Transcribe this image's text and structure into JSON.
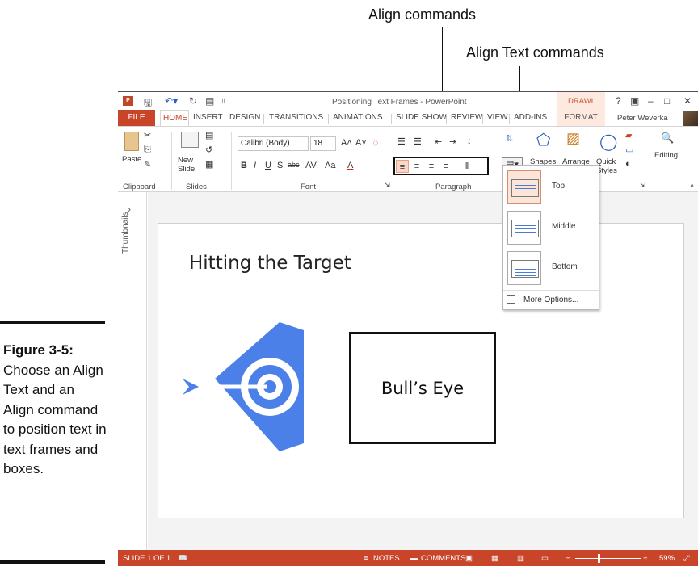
{
  "callouts": {
    "align_commands": "Align commands",
    "align_text_commands": "Align Text commands"
  },
  "figure": {
    "number": "Figure 3-5:",
    "caption": "Choose an Align Text and an Align command to position text in text frames and boxes."
  },
  "window": {
    "title": "Positioning Text Frames - PowerPoint",
    "context_tab": "DRAWI...",
    "user": "Peter Weverka",
    "help": "?"
  },
  "tabs": [
    "FILE",
    "HOME",
    "INSERT",
    "DESIGN",
    "TRANSITIONS",
    "ANIMATIONS",
    "SLIDE SHOW",
    "REVIEW",
    "VIEW",
    "ADD-INS",
    "FORMAT"
  ],
  "ribbon": {
    "clipboard": {
      "paste": "Paste",
      "group": "Clipboard"
    },
    "slides": {
      "new_slide": "New Slide",
      "group": "Slides"
    },
    "font": {
      "family": "Calibri (Body)",
      "size": "18",
      "group": "Font"
    },
    "paragraph": {
      "group": "Paragraph"
    },
    "drawing": {
      "shapes": "Shapes",
      "arrange": "Arrange",
      "quick_styles": "Quick Styles"
    },
    "editing": {
      "label": "Editing"
    }
  },
  "align_text_menu": {
    "items": [
      {
        "label": "Top",
        "selected": true
      },
      {
        "label": "Middle",
        "selected": false
      },
      {
        "label": "Bottom",
        "selected": false
      }
    ],
    "more": "More Options..."
  },
  "thumbnails": {
    "label": "Thumbnails"
  },
  "slide": {
    "title": "Hitting the Target",
    "box_text": "Bull’s Eye",
    "target_color": "#4a80e8"
  },
  "statusbar": {
    "slide": "SLIDE 1 OF 1",
    "notes": "NOTES",
    "comments": "COMMENTS",
    "zoom": "59%"
  },
  "colors": {
    "accent": "#c8452a",
    "callout_line": "#111111"
  }
}
